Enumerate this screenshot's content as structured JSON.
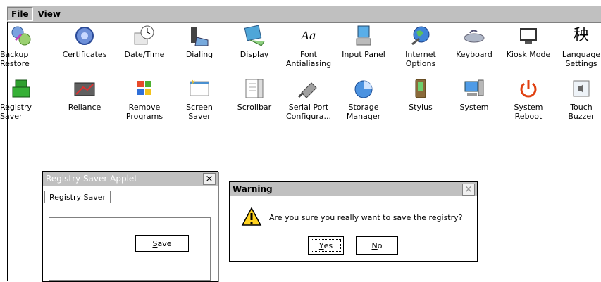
{
  "menubar": {
    "file": {
      "first": "F",
      "rest": "ile"
    },
    "view": {
      "first": "V",
      "rest": "iew"
    }
  },
  "icons_row1": [
    {
      "label": "Backup\nRestore",
      "icon": "backup-icon"
    },
    {
      "label": "Certificates",
      "icon": "certificates-icon"
    },
    {
      "label": "Date/Time",
      "icon": "datetime-icon"
    },
    {
      "label": "Dialing",
      "icon": "dialing-icon"
    },
    {
      "label": "Display",
      "icon": "display-icon"
    },
    {
      "label": "Font\nAntialiasing",
      "icon": "font-icon",
      "glyph": "Aa"
    },
    {
      "label": "Input Panel",
      "icon": "input-panel-icon"
    },
    {
      "label": "Internet\nOptions",
      "icon": "internet-icon"
    },
    {
      "label": "Keyboard",
      "icon": "keyboard-icon"
    },
    {
      "label": "Kiosk Mode",
      "icon": "kiosk-icon"
    },
    {
      "label": "Language\nSettings",
      "icon": "language-icon",
      "glyph": "秧"
    }
  ],
  "icons_row2": [
    {
      "label": "Registry\nSaver",
      "icon": "registry-icon"
    },
    {
      "label": "Reliance",
      "icon": "reliance-icon"
    },
    {
      "label": "Remove\nPrograms",
      "icon": "remove-programs-icon"
    },
    {
      "label": "Screen\nSaver",
      "icon": "screensaver-icon"
    },
    {
      "label": "Scrollbar",
      "icon": "scrollbar-icon"
    },
    {
      "label": "Serial Port\nConfigura...",
      "icon": "serial-port-icon"
    },
    {
      "label": "Storage\nManager",
      "icon": "storage-icon"
    },
    {
      "label": "Stylus",
      "icon": "stylus-icon"
    },
    {
      "label": "System",
      "icon": "system-icon"
    },
    {
      "label": "System\nReboot",
      "icon": "power-icon"
    },
    {
      "label": "Touch\nBuzzer",
      "icon": "buzzer-icon"
    }
  ],
  "applet": {
    "title": "Registry Saver Applet",
    "close": "×",
    "tab": "Registry Saver",
    "save": {
      "first": "S",
      "rest": "ave"
    }
  },
  "warning": {
    "title": "Warning",
    "close": "×",
    "message": "Are you sure you really want to save the registry?",
    "yes": {
      "first": "Y",
      "rest": "es"
    },
    "no": {
      "first": "N",
      "rest": "o"
    }
  }
}
